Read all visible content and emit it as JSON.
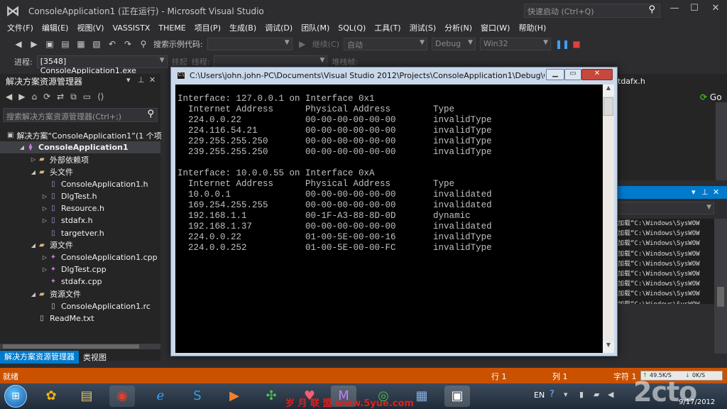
{
  "window": {
    "title": "ConsoleApplication1 (正在运行) - Microsoft Visual Studio",
    "quicklaunch_placeholder": "快速启动 (Ctrl+Q)"
  },
  "menu": [
    "文件(F)",
    "编辑(E)",
    "视图(V)",
    "VASSISTX",
    "THEME",
    "项目(P)",
    "生成(B)",
    "调试(D)",
    "团队(M)",
    "SQL(Q)",
    "工具(T)",
    "测试(S)",
    "分析(N)",
    "窗口(W)",
    "帮助(H)"
  ],
  "toolbar1": {
    "search_label": "搜索示例代码:",
    "continue_label": "继续(C)",
    "auto_value": "自动",
    "config_value": "Debug",
    "platform_value": "Win32"
  },
  "toolbar2": {
    "process_label": "进程:",
    "process_value": "[3548] ConsoleApplication1.exe",
    "suspend_label": "挂起",
    "thread_label": "线程:",
    "stack_label": "堆栈帧:"
  },
  "solution_explorer": {
    "title": "解决方案资源管理器",
    "search_placeholder": "搜索解决方案资源管理器(Ctrl+;)",
    "tabs": [
      "解决方案资源管理器",
      "类视图"
    ],
    "items": [
      {
        "label": "解决方案“ConsoleApplication1”(1 个项",
        "indent": 0,
        "toggle": "",
        "icon": "sol"
      },
      {
        "label": "ConsoleApplication1",
        "indent": 1,
        "toggle": "◢",
        "icon": "proj",
        "selected": true
      },
      {
        "label": "外部依赖项",
        "indent": 2,
        "toggle": "▷",
        "icon": "folder"
      },
      {
        "label": "头文件",
        "indent": 2,
        "toggle": "◢",
        "icon": "folder"
      },
      {
        "label": "ConsoleApplication1.h",
        "indent": 3,
        "toggle": "",
        "icon": "h"
      },
      {
        "label": "DlgTest.h",
        "indent": 3,
        "toggle": "▷",
        "icon": "h"
      },
      {
        "label": "Resource.h",
        "indent": 3,
        "toggle": "▷",
        "icon": "h"
      },
      {
        "label": "stdafx.h",
        "indent": 3,
        "toggle": "▷",
        "icon": "h"
      },
      {
        "label": "targetver.h",
        "indent": 3,
        "toggle": "",
        "icon": "h"
      },
      {
        "label": "源文件",
        "indent": 2,
        "toggle": "◢",
        "icon": "folder"
      },
      {
        "label": "ConsoleApplication1.cpp",
        "indent": 3,
        "toggle": "▷",
        "icon": "cpp"
      },
      {
        "label": "DlgTest.cpp",
        "indent": 3,
        "toggle": "▷",
        "icon": "cpp"
      },
      {
        "label": "stdafx.cpp",
        "indent": 3,
        "toggle": "",
        "icon": "cpp"
      },
      {
        "label": "资源文件",
        "indent": 2,
        "toggle": "◢",
        "icon": "folder"
      },
      {
        "label": "ConsoleApplication1.rc",
        "indent": 3,
        "toggle": "",
        "icon": "rc"
      },
      {
        "label": "ReadMe.txt",
        "indent": 2,
        "toggle": "",
        "icon": "txt"
      }
    ]
  },
  "right_panel": {
    "tab_label": "tdafx.h",
    "go_label": "Go",
    "output_lines": [
      "加载“C:\\Windows\\SysWOW",
      "加载“C:\\Windows\\SysWOW",
      "加载“C:\\Windows\\SysWOW",
      "加载“C:\\Windows\\SysWOW",
      "加载“C:\\Windows\\SysWOW",
      "加载“C:\\Windows\\SysWOW",
      "加载“C:\\Windows\\SysWOW",
      "加载“C:\\Windows\\SysWOW",
      "加载“C:\\Windows\\SysWOW"
    ]
  },
  "console": {
    "title": "C:\\Users\\john.john-PC\\Documents\\Visual Studio 2012\\Projects\\ConsoleApplication1\\Debug\\Console...",
    "lines": [
      "Interface: 127.0.0.1 on Interface 0x1",
      "  Internet Address      Physical Address        Type",
      "  224.0.0.22            00-00-00-00-00-00       invalidType",
      "  224.116.54.21         00-00-00-00-00-00       invalidType",
      "  229.255.255.250       00-00-00-00-00-00       invalidType",
      "  239.255.255.250       00-00-00-00-00-00       invalidType",
      "",
      "Interface: 10.0.0.55 on Interface 0xA",
      "  Internet Address      Physical Address        Type",
      "  10.0.0.1              00-00-00-00-00-00       invalidated",
      "  169.254.255.255       00-00-00-00-00-00       invalidated",
      "  192.168.1.1           00-1F-A3-88-8D-0D       dynamic",
      "  192.168.1.37          00-00-00-00-00-00       invalidated",
      "  224.0.0.22            01-00-5E-00-00-16       invalidType",
      "  224.0.0.252           01-00-5E-00-00-FC       invalidType"
    ]
  },
  "statusbar": {
    "left": "就绪",
    "row": "行 1",
    "col": "列 1",
    "char": "字符 1",
    "net_up": "49.5K/S",
    "net_down": "0K/S"
  },
  "taskbar": {
    "lang": "EN",
    "date": "9/17/2012",
    "watermark": "2cto",
    "watermark_cn": "岁 月 联 盟  www.5yue.com"
  }
}
